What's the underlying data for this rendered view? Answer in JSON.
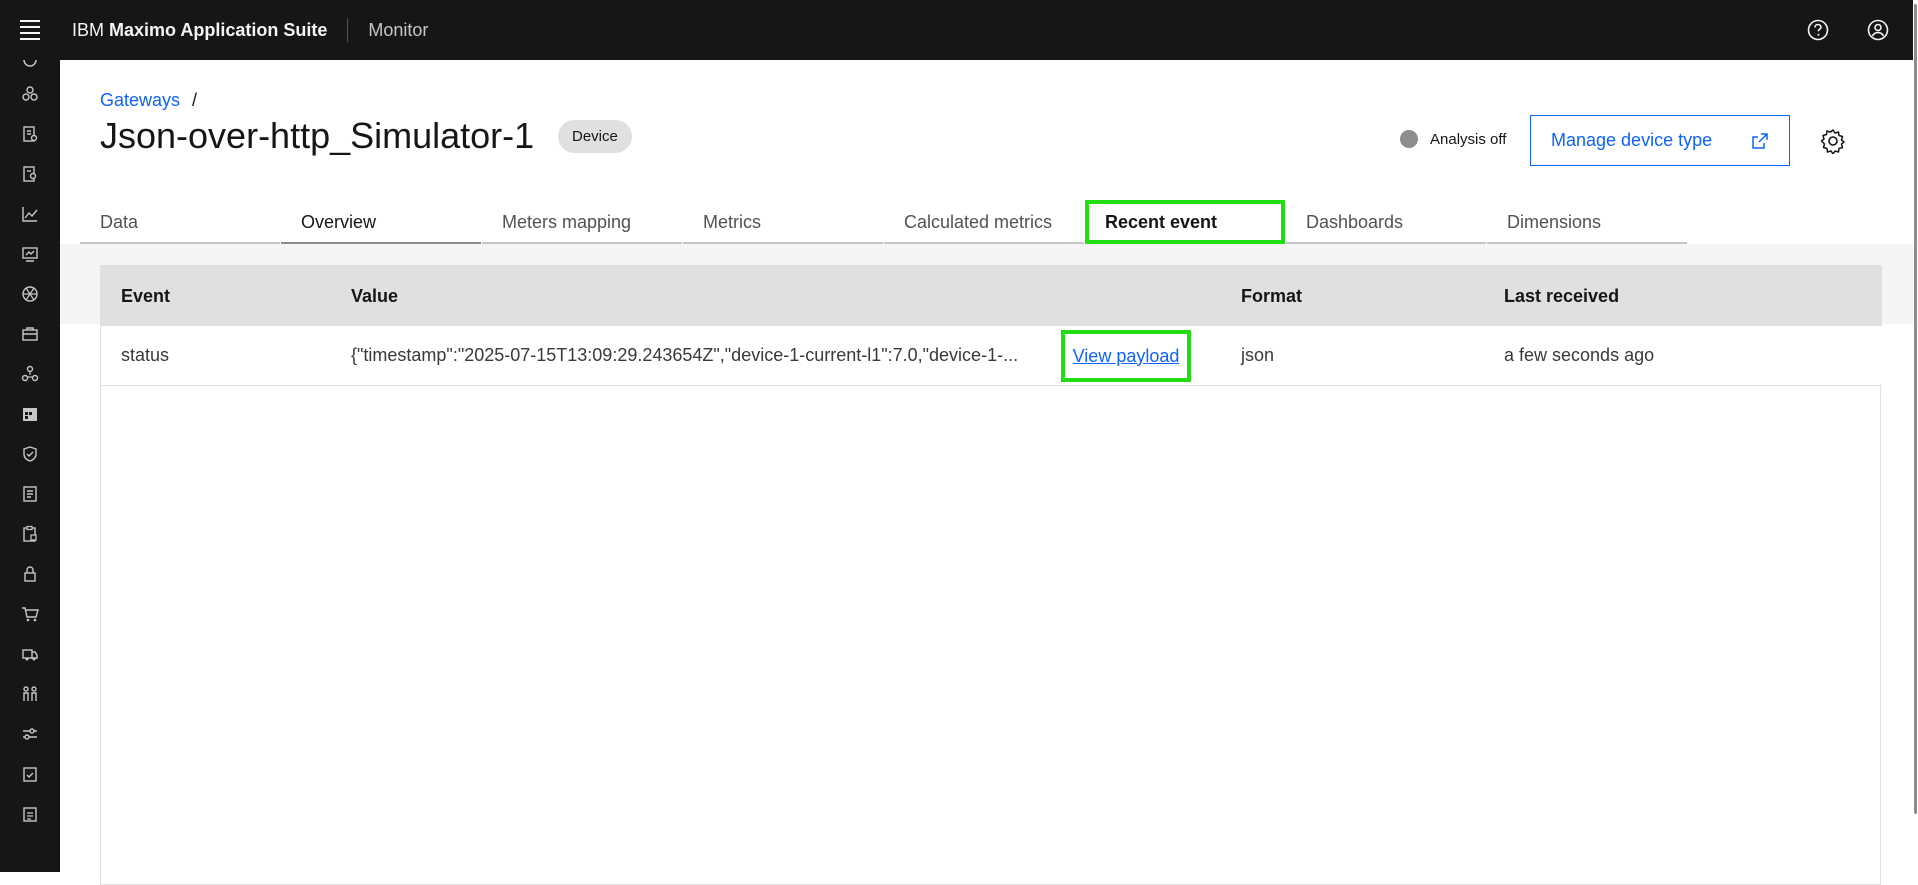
{
  "header": {
    "brand_prefix": "IBM",
    "brand_name": "Maximo Application Suite",
    "app_name": "Monitor"
  },
  "breadcrumb": {
    "link": "Gateways",
    "separator": "/"
  },
  "page": {
    "title": "Json-over-http_Simulator-1",
    "tag": "Device",
    "analysis_status": "Analysis off",
    "manage_button": "Manage device type"
  },
  "tabs": [
    {
      "label": "Data"
    },
    {
      "label": "Overview"
    },
    {
      "label": "Meters mapping"
    },
    {
      "label": "Metrics"
    },
    {
      "label": "Calculated metrics"
    },
    {
      "label": "Recent event"
    },
    {
      "label": "Dashboards"
    },
    {
      "label": "Dimensions"
    }
  ],
  "table": {
    "columns": [
      "Event",
      "Value",
      "Format",
      "Last received"
    ],
    "rows": [
      {
        "event": "status",
        "value": "{\"timestamp\":\"2025-07-15T13:09:29.243654Z\",\"device-1-current-l1\":7.0,\"device-1-...",
        "action": "View payload",
        "format": "json",
        "last_received": "a few seconds ago"
      }
    ]
  },
  "colors": {
    "header_bg": "#161616",
    "link": "#0f62fe",
    "highlight": "#22dd11"
  }
}
